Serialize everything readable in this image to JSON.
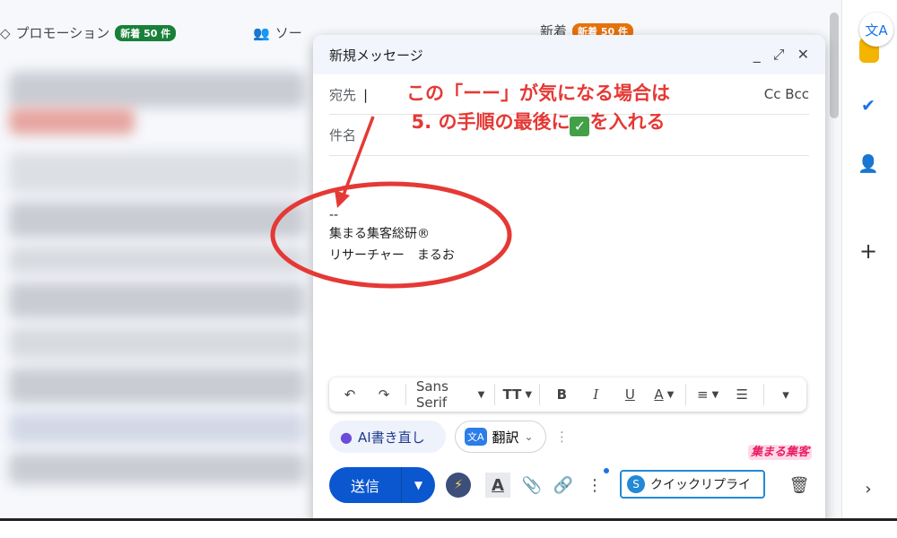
{
  "tabs": [
    {
      "label": "プロモーション",
      "badge": "新着 50 件",
      "badge_color": "#188038"
    },
    {
      "label": "ソー"
    },
    {
      "label": "新着",
      "badge": "新着 50 件",
      "badge_color": "#e8710a"
    }
  ],
  "compose": {
    "title": "新規メッセージ",
    "to_label": "宛先",
    "cc_bcc": "Cc Bcc",
    "subject_label": "件名",
    "signature": {
      "dashes": "--",
      "line1": "集まる集客総研®",
      "line2": "リサーチャー　まるお"
    }
  },
  "toolbar": {
    "undo": "↶",
    "redo": "↷",
    "font": "Sans Serif",
    "font_size": "TT",
    "bold": "B",
    "italic": "I",
    "underline": "U",
    "text_color": "A",
    "align": "≡",
    "list": "☰",
    "more": "▾"
  },
  "actions": {
    "ai_rewrite": "AI書き直し",
    "translate": "翻訳"
  },
  "send": {
    "label": "送信"
  },
  "quick_reply": "クイックリプライ",
  "annotation": {
    "line1": "この「ーー」が気になる場合は",
    "line2_prefix": "5. の手順の最後に",
    "line2_suffix": "を入れる"
  },
  "watermark": "集まる集客",
  "colors": {
    "accent": "#0b57d0",
    "annotation": "#e53935",
    "quick_border": "#2389d6"
  }
}
